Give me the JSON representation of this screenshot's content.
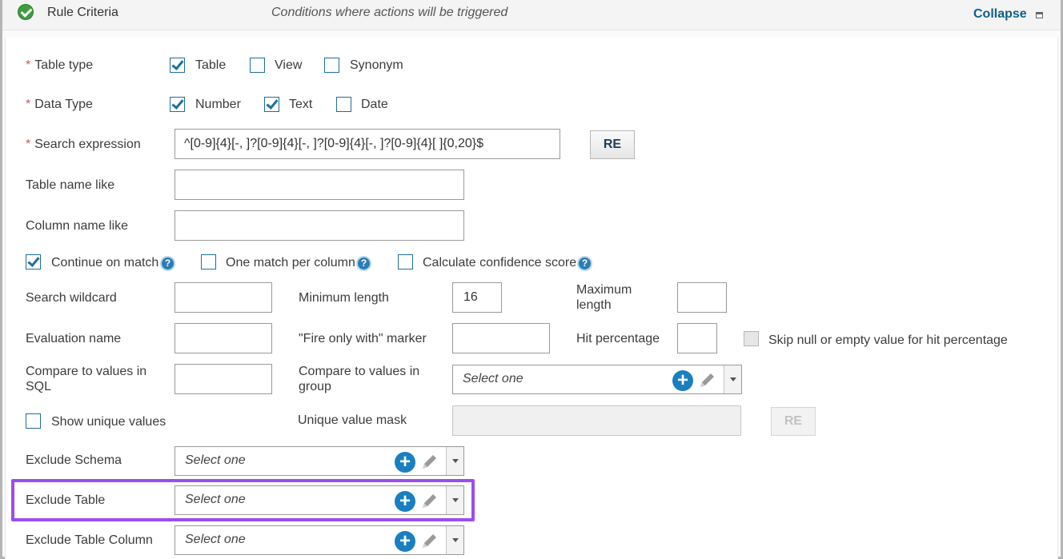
{
  "header": {
    "title": "Rule Criteria",
    "subtitle": "Conditions where actions will be triggered",
    "collapse_label": "Collapse"
  },
  "required_mark": "*",
  "help_glyph": "?",
  "plus_glyph": "+",
  "table_type": {
    "label": "Table type",
    "options": [
      {
        "label": "Table",
        "checked": true
      },
      {
        "label": "View",
        "checked": false
      },
      {
        "label": "Synonym",
        "checked": false
      }
    ]
  },
  "data_type": {
    "label": "Data Type",
    "options": [
      {
        "label": "Number",
        "checked": true
      },
      {
        "label": "Text",
        "checked": true
      },
      {
        "label": "Date",
        "checked": false
      }
    ]
  },
  "search_expression": {
    "label": "Search expression",
    "value": "^[0-9]{4}[-, ]?[0-9]{4}[-, ]?[0-9]{4}[-, ]?[0-9]{4}[ ]{0,20}$",
    "re_button": "RE"
  },
  "table_name_like": {
    "label": "Table name like",
    "value": ""
  },
  "column_name_like": {
    "label": "Column name like",
    "value": ""
  },
  "options": {
    "continue_on_match": {
      "label": "Continue on match",
      "checked": true
    },
    "one_match_per_column": {
      "label": "One match per column",
      "checked": false
    },
    "calculate_confidence": {
      "label": "Calculate confidence score",
      "checked": false
    }
  },
  "search_wildcard": {
    "label": "Search wildcard",
    "value": ""
  },
  "minimum_length": {
    "label": "Minimum length",
    "value": "16"
  },
  "maximum_length": {
    "label": "Maximum length",
    "value": ""
  },
  "evaluation_name": {
    "label": "Evaluation name",
    "value": ""
  },
  "fire_only_with_marker": {
    "label": "\"Fire only with\" marker",
    "value": ""
  },
  "hit_percentage": {
    "label": "Hit percentage",
    "value": ""
  },
  "skip_null": {
    "label": "Skip null or empty value for hit percentage",
    "checked": false
  },
  "compare_sql": {
    "label": "Compare to values in SQL",
    "value": ""
  },
  "compare_group": {
    "label": "Compare to values in group",
    "placeholder": "Select one"
  },
  "show_unique": {
    "label": "Show unique values",
    "checked": false
  },
  "unique_value_mask": {
    "label": "Unique value mask",
    "value": "",
    "re_button": "RE"
  },
  "exclude_schema": {
    "label": "Exclude Schema",
    "placeholder": "Select one"
  },
  "exclude_table": {
    "label": "Exclude Table",
    "placeholder": "Select one"
  },
  "exclude_table_column": {
    "label": "Exclude Table Column",
    "placeholder": "Select one"
  },
  "colors": {
    "accent": "#1f6e9c",
    "highlight": "#9b4df0",
    "required": "#d9534f"
  }
}
